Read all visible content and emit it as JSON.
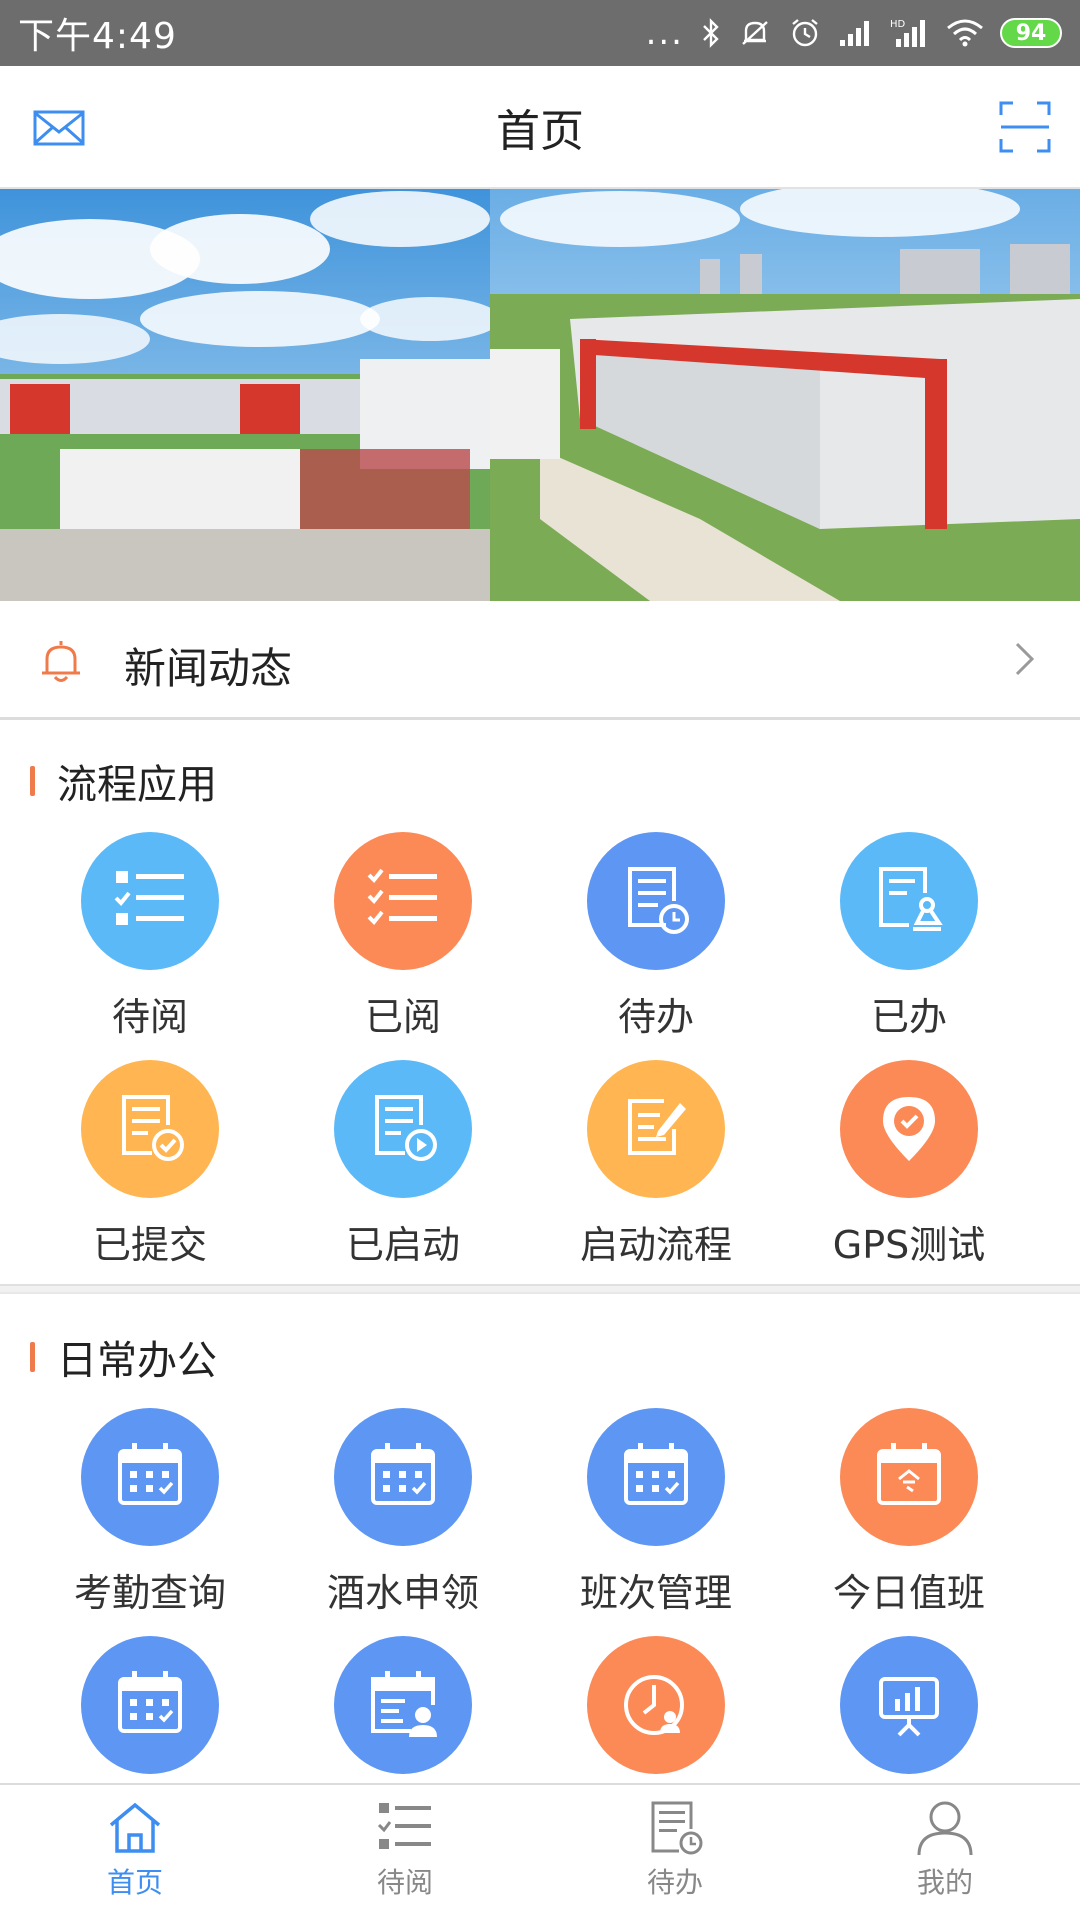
{
  "status_bar": {
    "time": "下午4:49",
    "dots": "...",
    "battery": "94",
    "icons": [
      "bluetooth-icon",
      "mute-bell-icon",
      "alarm-icon",
      "signal-icon",
      "hd-signal-icon",
      "wifi-icon",
      "battery-icon"
    ]
  },
  "header": {
    "title": "首页",
    "left_icon": "mail-icon",
    "right_icon": "scan-icon"
  },
  "banner": {
    "image": "factory-campus-photo"
  },
  "news": {
    "label": "新闻动态",
    "icon": "bell-icon"
  },
  "process_section": {
    "title": "流程应用",
    "items": [
      {
        "label": "待阅",
        "icon": "todo-read-list-icon",
        "color": "#5cb9f8"
      },
      {
        "label": "已阅",
        "icon": "read-checklist-icon",
        "color": "#fb8a57"
      },
      {
        "label": "待办",
        "icon": "todo-doc-clock-icon",
        "color": "#5e96f4"
      },
      {
        "label": "已办",
        "icon": "done-doc-stamp-icon",
        "color": "#5cb9f8"
      },
      {
        "label": "已提交",
        "icon": "submitted-doc-check-icon",
        "color": "#ffb551"
      },
      {
        "label": "已启动",
        "icon": "started-doc-play-icon",
        "color": "#5cb9f8"
      },
      {
        "label": "启动流程",
        "icon": "start-process-edit-icon",
        "color": "#ffb551"
      },
      {
        "label": "GPS测试",
        "icon": "gps-pin-icon",
        "color": "#fb8a57"
      }
    ]
  },
  "office_section": {
    "title": "日常办公",
    "items": [
      {
        "label": "考勤查询",
        "icon": "calendar-check-icon",
        "color": "#5e96f4"
      },
      {
        "label": "酒水申领",
        "icon": "calendar-check-icon",
        "color": "#5e96f4"
      },
      {
        "label": "班次管理",
        "icon": "calendar-check-icon",
        "color": "#5e96f4"
      },
      {
        "label": "今日值班",
        "icon": "calendar-today-icon",
        "color": "#fb8a57"
      },
      {
        "label": "",
        "icon": "calendar-check-icon",
        "color": "#5e96f4"
      },
      {
        "label": "",
        "icon": "calendar-person-icon",
        "color": "#5e96f4"
      },
      {
        "label": "",
        "icon": "clock-person-icon",
        "color": "#fb8a57"
      },
      {
        "label": "",
        "icon": "presentation-chart-icon",
        "color": "#5e96f4"
      }
    ]
  },
  "tabbar": {
    "active_color": "#3d8ef0",
    "items": [
      {
        "label": "首页",
        "icon": "home-icon",
        "active": true
      },
      {
        "label": "待阅",
        "icon": "list-icon",
        "active": false
      },
      {
        "label": "待办",
        "icon": "doc-clock-icon",
        "active": false
      },
      {
        "label": "我的",
        "icon": "person-icon",
        "active": false
      }
    ]
  }
}
